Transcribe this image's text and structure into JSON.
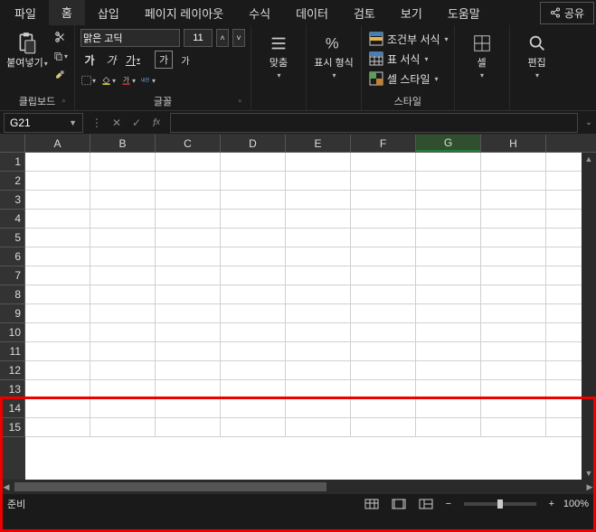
{
  "tabs": {
    "file": "파일",
    "home": "홈",
    "insert": "삽입",
    "layout": "페이지 레이아웃",
    "formulas": "수식",
    "data": "데이터",
    "review": "검토",
    "view": "보기",
    "help": "도움말"
  },
  "share_label": "공유",
  "ribbon": {
    "clipboard": {
      "label": "클립보드",
      "paste": "붙여넣기"
    },
    "font": {
      "label": "글꼴",
      "name": "맑은 고딕",
      "size": "11",
      "bold": "가",
      "italic": "가",
      "underline": "가",
      "boxed": "가",
      "super": "가"
    },
    "alignment": {
      "label": "맞춤"
    },
    "number": {
      "label": "표시 형식"
    },
    "styles": {
      "label": "스타일",
      "conditional": "조건부 서식",
      "table_format": "표 서식",
      "cell_style": "셀 스타일"
    },
    "cells": {
      "label": "셀"
    },
    "editing": {
      "label": "편집"
    }
  },
  "name_box": "G21",
  "columns": [
    "A",
    "B",
    "C",
    "D",
    "E",
    "F",
    "G",
    "H"
  ],
  "selected_col": "G",
  "rows": [
    1,
    2,
    3,
    4,
    5,
    6,
    7,
    8,
    9,
    10,
    11,
    12,
    13,
    14,
    15
  ],
  "status": {
    "ready": "준비",
    "zoom": "100%"
  },
  "chart_data": null
}
